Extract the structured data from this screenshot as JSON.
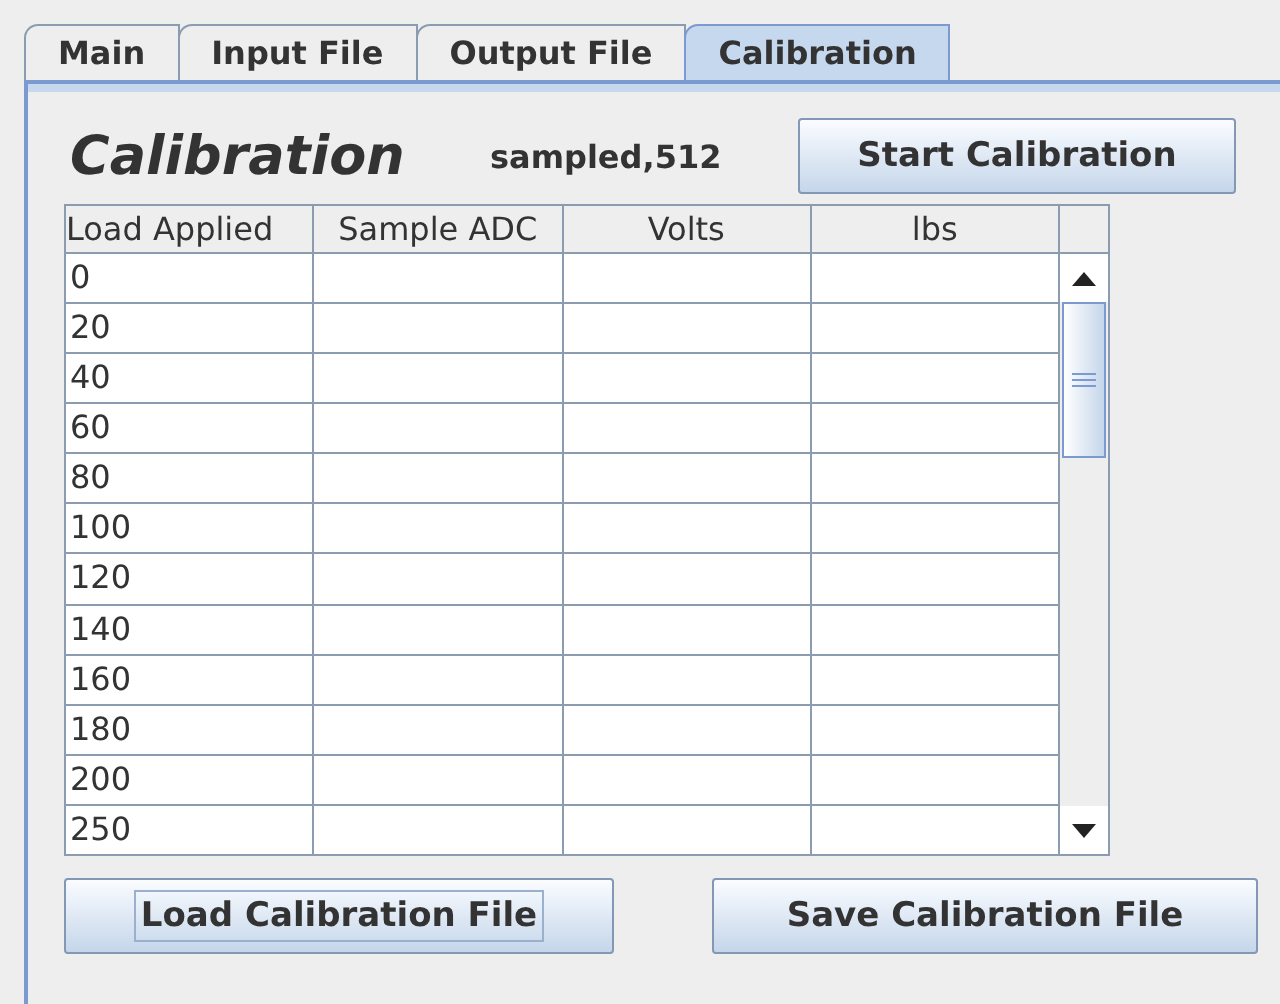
{
  "tabs": [
    {
      "label": "Main",
      "selected": false
    },
    {
      "label": "Input File",
      "selected": false
    },
    {
      "label": "Output File",
      "selected": false
    },
    {
      "label": "Calibration",
      "selected": true
    }
  ],
  "heading": "Calibration",
  "status": "sampled,512",
  "start_button": {
    "label": "Start Calibration",
    "focused": false
  },
  "table": {
    "columns": [
      "Load Applied",
      "Sample ADC",
      "Volts",
      "lbs"
    ],
    "rows": [
      [
        "0",
        "",
        "",
        ""
      ],
      [
        "20",
        "",
        "",
        ""
      ],
      [
        "40",
        "",
        "",
        ""
      ],
      [
        "60",
        "",
        "",
        ""
      ],
      [
        "80",
        "",
        "",
        ""
      ],
      [
        "100",
        "",
        "",
        ""
      ],
      [
        "120",
        "",
        "",
        ""
      ],
      [
        "140",
        "",
        "",
        ""
      ],
      [
        "160",
        "",
        "",
        ""
      ],
      [
        "180",
        "",
        "",
        ""
      ],
      [
        "200",
        "",
        "",
        ""
      ],
      [
        "250",
        "",
        "",
        ""
      ]
    ]
  },
  "buttons": [
    {
      "label": "Load Calibration File",
      "focused": true
    },
    {
      "label": "Save Calibration File",
      "focused": false
    }
  ]
}
